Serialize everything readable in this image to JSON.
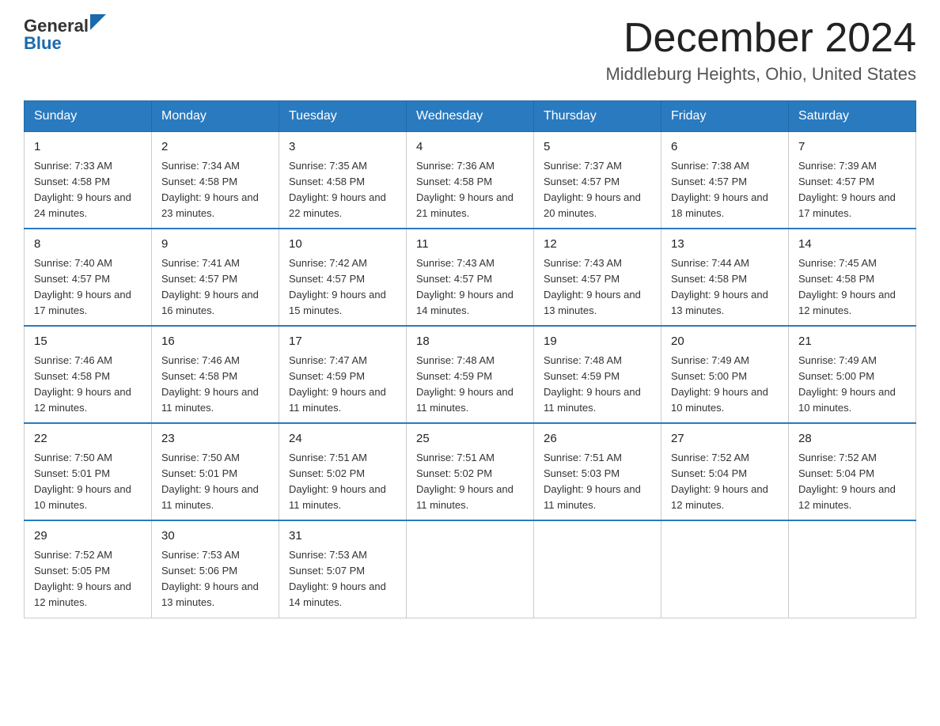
{
  "logo": {
    "general": "General",
    "blue": "Blue"
  },
  "header": {
    "month_year": "December 2024",
    "location": "Middleburg Heights, Ohio, United States"
  },
  "weekdays": [
    "Sunday",
    "Monday",
    "Tuesday",
    "Wednesday",
    "Thursday",
    "Friday",
    "Saturday"
  ],
  "weeks": [
    [
      {
        "day": "1",
        "sunrise": "Sunrise: 7:33 AM",
        "sunset": "Sunset: 4:58 PM",
        "daylight": "Daylight: 9 hours and 24 minutes."
      },
      {
        "day": "2",
        "sunrise": "Sunrise: 7:34 AM",
        "sunset": "Sunset: 4:58 PM",
        "daylight": "Daylight: 9 hours and 23 minutes."
      },
      {
        "day": "3",
        "sunrise": "Sunrise: 7:35 AM",
        "sunset": "Sunset: 4:58 PM",
        "daylight": "Daylight: 9 hours and 22 minutes."
      },
      {
        "day": "4",
        "sunrise": "Sunrise: 7:36 AM",
        "sunset": "Sunset: 4:58 PM",
        "daylight": "Daylight: 9 hours and 21 minutes."
      },
      {
        "day": "5",
        "sunrise": "Sunrise: 7:37 AM",
        "sunset": "Sunset: 4:57 PM",
        "daylight": "Daylight: 9 hours and 20 minutes."
      },
      {
        "day": "6",
        "sunrise": "Sunrise: 7:38 AM",
        "sunset": "Sunset: 4:57 PM",
        "daylight": "Daylight: 9 hours and 18 minutes."
      },
      {
        "day": "7",
        "sunrise": "Sunrise: 7:39 AM",
        "sunset": "Sunset: 4:57 PM",
        "daylight": "Daylight: 9 hours and 17 minutes."
      }
    ],
    [
      {
        "day": "8",
        "sunrise": "Sunrise: 7:40 AM",
        "sunset": "Sunset: 4:57 PM",
        "daylight": "Daylight: 9 hours and 17 minutes."
      },
      {
        "day": "9",
        "sunrise": "Sunrise: 7:41 AM",
        "sunset": "Sunset: 4:57 PM",
        "daylight": "Daylight: 9 hours and 16 minutes."
      },
      {
        "day": "10",
        "sunrise": "Sunrise: 7:42 AM",
        "sunset": "Sunset: 4:57 PM",
        "daylight": "Daylight: 9 hours and 15 minutes."
      },
      {
        "day": "11",
        "sunrise": "Sunrise: 7:43 AM",
        "sunset": "Sunset: 4:57 PM",
        "daylight": "Daylight: 9 hours and 14 minutes."
      },
      {
        "day": "12",
        "sunrise": "Sunrise: 7:43 AM",
        "sunset": "Sunset: 4:57 PM",
        "daylight": "Daylight: 9 hours and 13 minutes."
      },
      {
        "day": "13",
        "sunrise": "Sunrise: 7:44 AM",
        "sunset": "Sunset: 4:58 PM",
        "daylight": "Daylight: 9 hours and 13 minutes."
      },
      {
        "day": "14",
        "sunrise": "Sunrise: 7:45 AM",
        "sunset": "Sunset: 4:58 PM",
        "daylight": "Daylight: 9 hours and 12 minutes."
      }
    ],
    [
      {
        "day": "15",
        "sunrise": "Sunrise: 7:46 AM",
        "sunset": "Sunset: 4:58 PM",
        "daylight": "Daylight: 9 hours and 12 minutes."
      },
      {
        "day": "16",
        "sunrise": "Sunrise: 7:46 AM",
        "sunset": "Sunset: 4:58 PM",
        "daylight": "Daylight: 9 hours and 11 minutes."
      },
      {
        "day": "17",
        "sunrise": "Sunrise: 7:47 AM",
        "sunset": "Sunset: 4:59 PM",
        "daylight": "Daylight: 9 hours and 11 minutes."
      },
      {
        "day": "18",
        "sunrise": "Sunrise: 7:48 AM",
        "sunset": "Sunset: 4:59 PM",
        "daylight": "Daylight: 9 hours and 11 minutes."
      },
      {
        "day": "19",
        "sunrise": "Sunrise: 7:48 AM",
        "sunset": "Sunset: 4:59 PM",
        "daylight": "Daylight: 9 hours and 11 minutes."
      },
      {
        "day": "20",
        "sunrise": "Sunrise: 7:49 AM",
        "sunset": "Sunset: 5:00 PM",
        "daylight": "Daylight: 9 hours and 10 minutes."
      },
      {
        "day": "21",
        "sunrise": "Sunrise: 7:49 AM",
        "sunset": "Sunset: 5:00 PM",
        "daylight": "Daylight: 9 hours and 10 minutes."
      }
    ],
    [
      {
        "day": "22",
        "sunrise": "Sunrise: 7:50 AM",
        "sunset": "Sunset: 5:01 PM",
        "daylight": "Daylight: 9 hours and 10 minutes."
      },
      {
        "day": "23",
        "sunrise": "Sunrise: 7:50 AM",
        "sunset": "Sunset: 5:01 PM",
        "daylight": "Daylight: 9 hours and 11 minutes."
      },
      {
        "day": "24",
        "sunrise": "Sunrise: 7:51 AM",
        "sunset": "Sunset: 5:02 PM",
        "daylight": "Daylight: 9 hours and 11 minutes."
      },
      {
        "day": "25",
        "sunrise": "Sunrise: 7:51 AM",
        "sunset": "Sunset: 5:02 PM",
        "daylight": "Daylight: 9 hours and 11 minutes."
      },
      {
        "day": "26",
        "sunrise": "Sunrise: 7:51 AM",
        "sunset": "Sunset: 5:03 PM",
        "daylight": "Daylight: 9 hours and 11 minutes."
      },
      {
        "day": "27",
        "sunrise": "Sunrise: 7:52 AM",
        "sunset": "Sunset: 5:04 PM",
        "daylight": "Daylight: 9 hours and 12 minutes."
      },
      {
        "day": "28",
        "sunrise": "Sunrise: 7:52 AM",
        "sunset": "Sunset: 5:04 PM",
        "daylight": "Daylight: 9 hours and 12 minutes."
      }
    ],
    [
      {
        "day": "29",
        "sunrise": "Sunrise: 7:52 AM",
        "sunset": "Sunset: 5:05 PM",
        "daylight": "Daylight: 9 hours and 12 minutes."
      },
      {
        "day": "30",
        "sunrise": "Sunrise: 7:53 AM",
        "sunset": "Sunset: 5:06 PM",
        "daylight": "Daylight: 9 hours and 13 minutes."
      },
      {
        "day": "31",
        "sunrise": "Sunrise: 7:53 AM",
        "sunset": "Sunset: 5:07 PM",
        "daylight": "Daylight: 9 hours and 14 minutes."
      },
      null,
      null,
      null,
      null
    ]
  ]
}
